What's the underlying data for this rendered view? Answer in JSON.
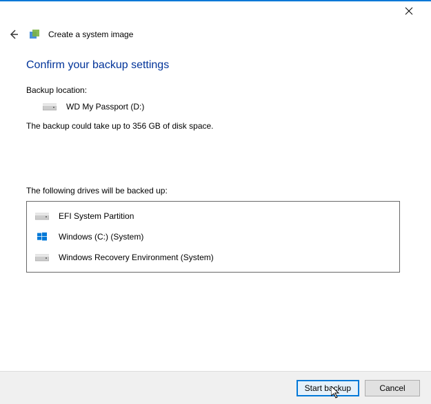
{
  "window": {
    "title": "Create a system image"
  },
  "heading": "Confirm your backup settings",
  "backup": {
    "loc_label": "Backup location:",
    "destination": "WD My Passport (D:)",
    "space_note": "The backup could take up to 356 GB of disk space."
  },
  "drives": {
    "label": "The following drives will be backed up:",
    "list": [
      {
        "name": "EFI System Partition",
        "type": "generic"
      },
      {
        "name": "Windows (C:) (System)",
        "type": "windows"
      },
      {
        "name": "Windows Recovery Environment (System)",
        "type": "generic"
      }
    ]
  },
  "buttons": {
    "start": "Start backup",
    "cancel": "Cancel"
  }
}
